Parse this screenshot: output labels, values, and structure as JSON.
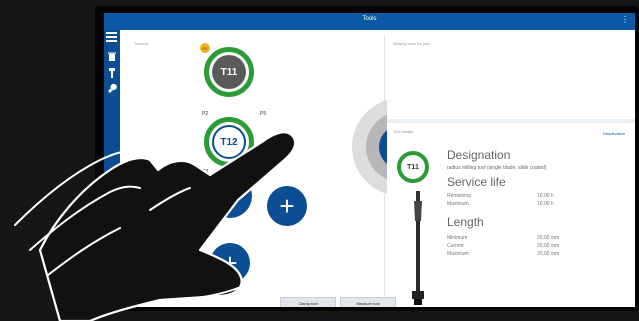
{
  "app": {
    "title": "Tools",
    "more_icon": "more-vertical-icon"
  },
  "sidebar": {
    "icons": [
      "menu-icon",
      "trash-icon",
      "tool-icon",
      "wrench-icon"
    ]
  },
  "left_panel": {
    "label": "Toolsets",
    "tools": [
      {
        "slot": "P1",
        "name": "T11"
      },
      {
        "slot": "P2",
        "name": "T12"
      },
      {
        "slot": "P3",
        "name": ""
      },
      {
        "slot": "P5",
        "name": ""
      }
    ]
  },
  "missing_panel": {
    "label": "Missing tools for jobs"
  },
  "details": {
    "label": "Tool details",
    "restore_label": "Deactivation",
    "tool_badge": "T11",
    "designation_heading": "Designation",
    "designation_text": "radius milling tool (single blade, slide coated)",
    "service_heading": "Service life",
    "service": [
      {
        "key": "Remaining",
        "value": "10:00 h"
      },
      {
        "key": "Maximum",
        "value": "10:00 h"
      }
    ],
    "length_heading": "Length",
    "length": [
      {
        "key": "Minimum",
        "value": "20,00 mm"
      },
      {
        "key": "Current",
        "value": "20,00 mm"
      },
      {
        "key": "Maximum",
        "value": "30,00 mm"
      }
    ]
  },
  "bottom": {
    "buttons": [
      "Clamp tool",
      "Measure tool"
    ]
  },
  "colors": {
    "accent": "#0c5aa6",
    "ring": "#2a9b35",
    "dark_button": "#0c4e93"
  }
}
